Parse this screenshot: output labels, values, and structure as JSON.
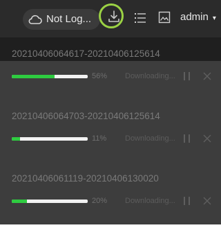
{
  "topbar": {
    "cloud": {
      "icon": "cloud-icon",
      "label": "Not Log..."
    },
    "download": {
      "icon": "download-icon"
    },
    "list": {
      "icon": "list-icon"
    },
    "image": {
      "icon": "image-icon"
    },
    "user": {
      "label": "admin",
      "caret": "▾"
    }
  },
  "colors": {
    "topbar_bg": "#2b2b2b",
    "panel_bg": "#3d3d3d",
    "progress_fill": "#2ecc40",
    "highlight_ring": "#9bd244"
  },
  "tasks": [
    {
      "name": "20210406064617-20210406125614",
      "progress": 0.56,
      "percent_label": "56%",
      "status": "Downloading...",
      "pause_icon": "pause-icon",
      "cancel_icon": "close-icon"
    },
    {
      "name": "20210406064703-20210406125614",
      "progress": 0.11,
      "percent_label": "11%",
      "status": "Downloading...",
      "pause_icon": "pause-icon",
      "cancel_icon": "close-icon"
    },
    {
      "name": "20210406061119-20210406130020",
      "progress": 0.2,
      "percent_label": "20%",
      "status": "Downloading...",
      "pause_icon": "pause-icon",
      "cancel_icon": "close-icon"
    }
  ]
}
